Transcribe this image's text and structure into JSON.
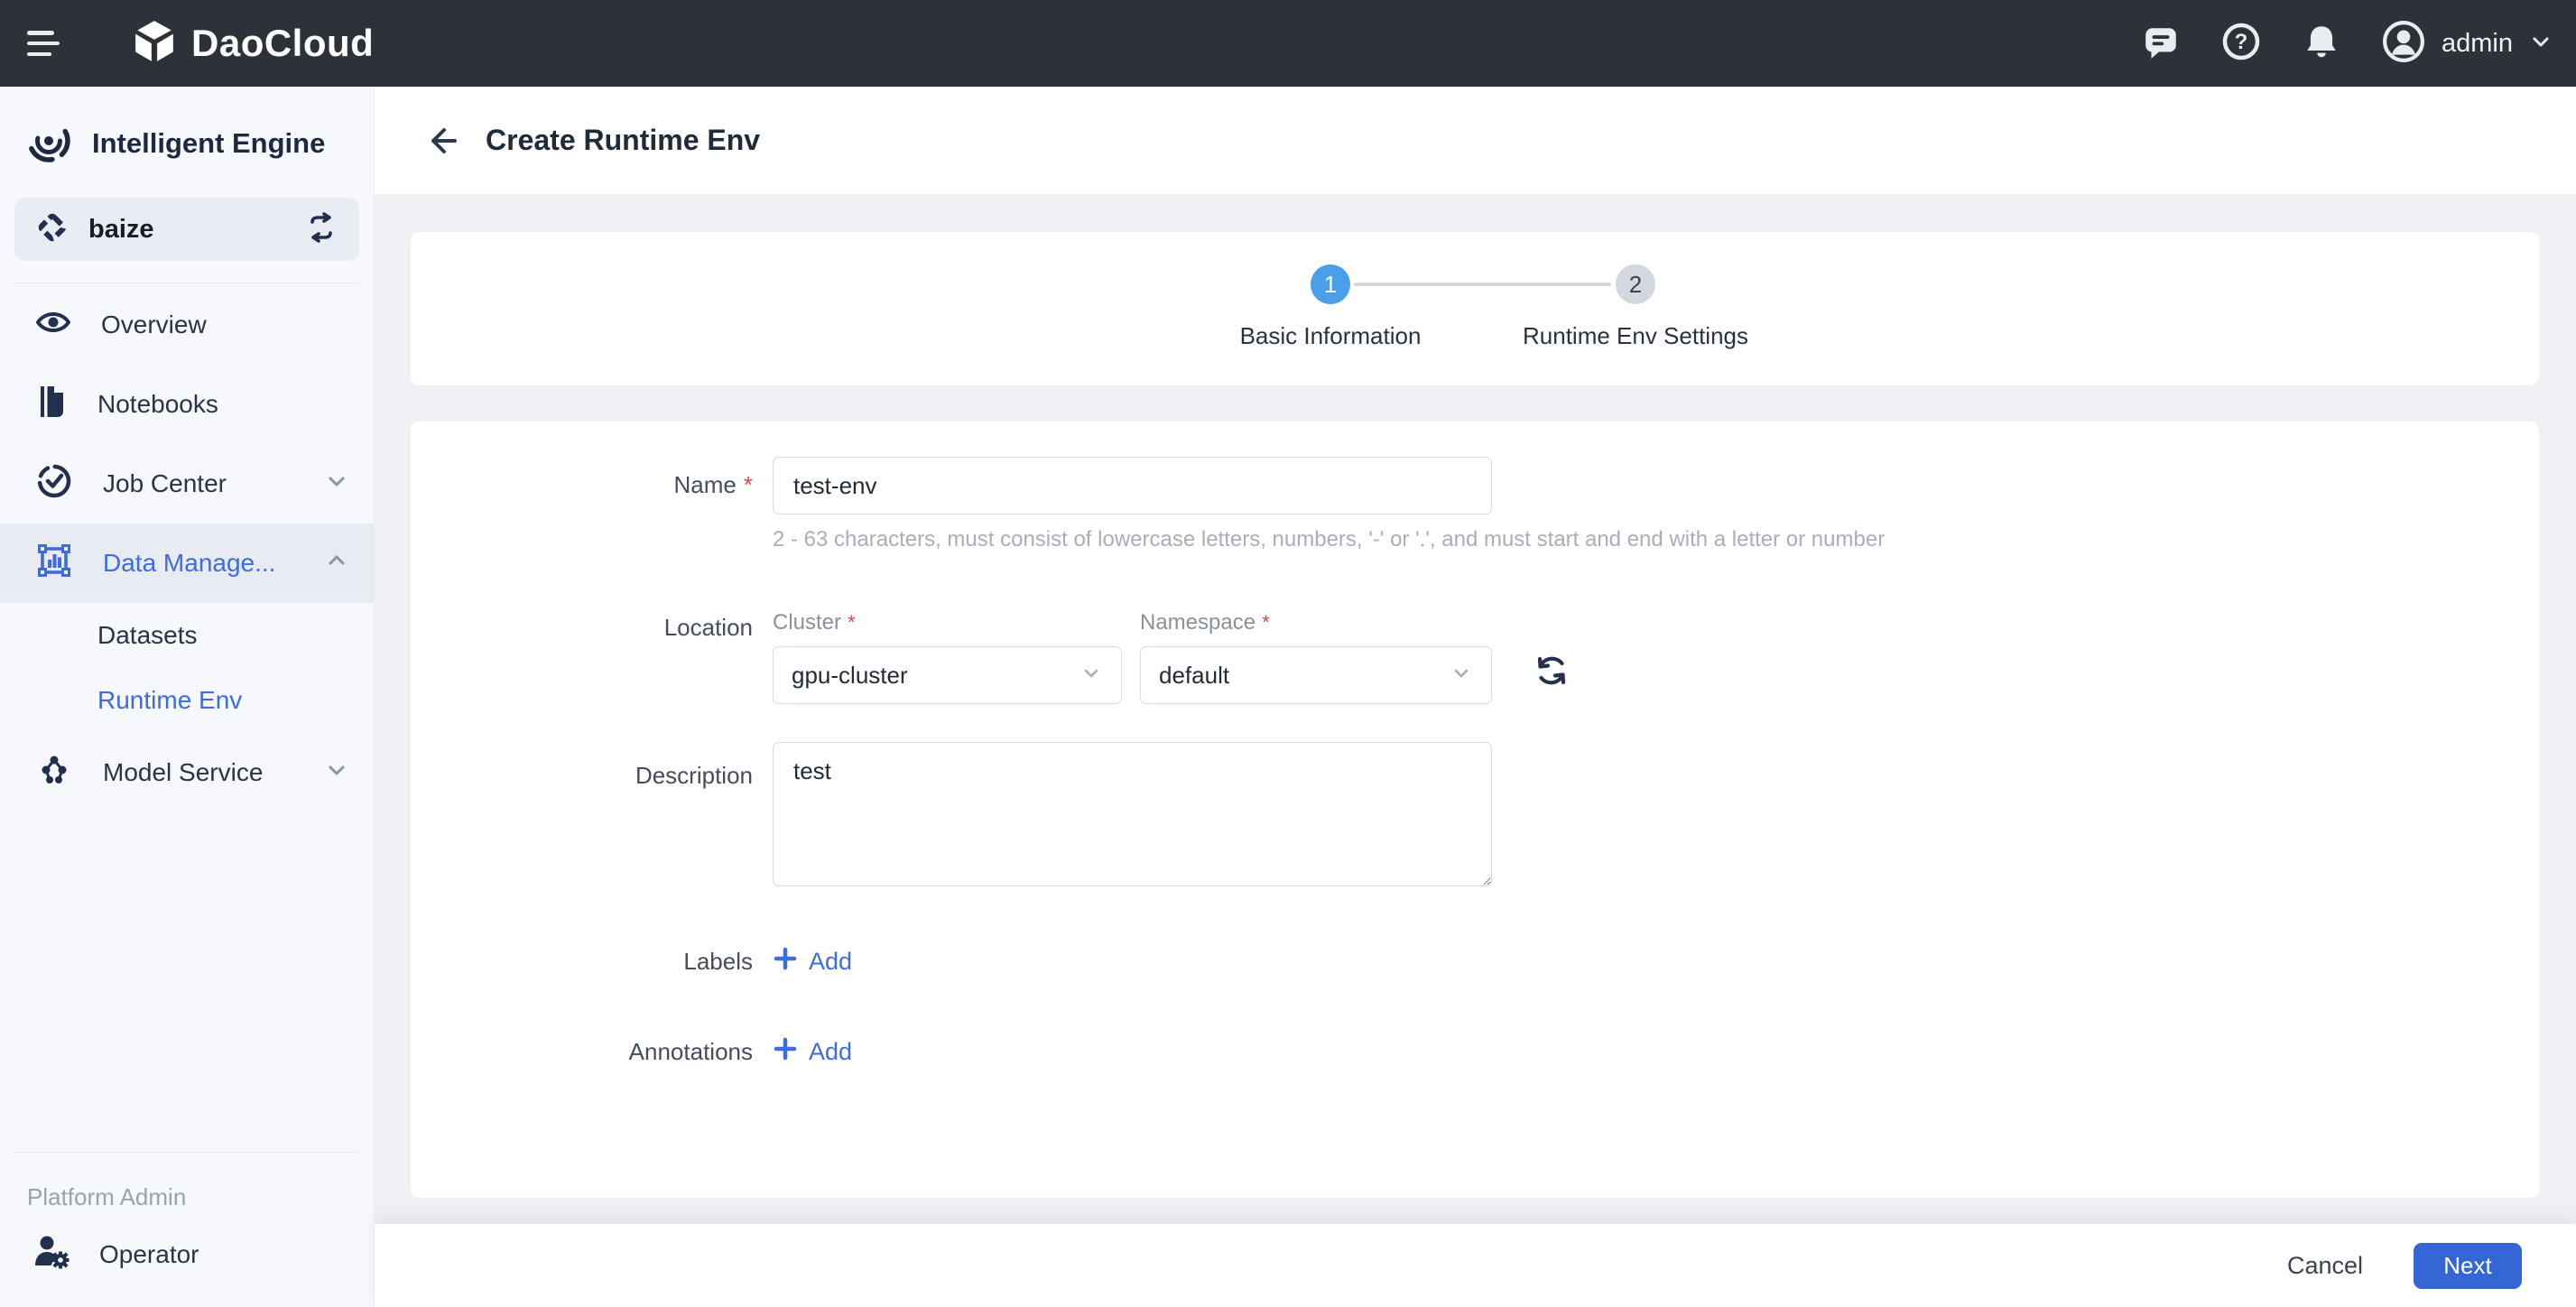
{
  "topbar": {
    "brand": "DaoCloud",
    "user": "admin"
  },
  "sidebar": {
    "product": "Intelligent Engine",
    "workspace": "baize",
    "menu": [
      {
        "label": "Overview"
      },
      {
        "label": "Notebooks"
      },
      {
        "label": "Job Center"
      },
      {
        "label": "Data Manage..."
      },
      {
        "label": "Datasets"
      },
      {
        "label": "Runtime Env"
      },
      {
        "label": "Model Service"
      }
    ],
    "section_label": "Platform Admin",
    "operator": "Operator"
  },
  "page": {
    "title": "Create Runtime Env",
    "steps": [
      {
        "number": "1",
        "label": "Basic Information"
      },
      {
        "number": "2",
        "label": "Runtime Env Settings"
      }
    ],
    "form": {
      "required_marker": "*",
      "name_label": "Name",
      "name_value": "test-env",
      "name_help": "2 - 63 characters, must consist of lowercase letters, numbers, '-' or '.', and must start and end with a letter or number",
      "location_label": "Location",
      "cluster_label": "Cluster",
      "cluster_value": "gpu-cluster",
      "namespace_label": "Namespace",
      "namespace_value": "default",
      "description_label": "Description",
      "description_value": "test",
      "labels_label": "Labels",
      "annotations_label": "Annotations",
      "add_label": "Add"
    },
    "footer": {
      "cancel": "Cancel",
      "next": "Next"
    }
  },
  "colors": {
    "topbar_bg": "#2d3138",
    "accent_blue": "#3e6be0",
    "step_active_blue": "#4aa0e8",
    "primary_button_blue": "#3566d6",
    "sidebar_bg": "#f7f8fb",
    "content_bg": "#eff1f5"
  }
}
